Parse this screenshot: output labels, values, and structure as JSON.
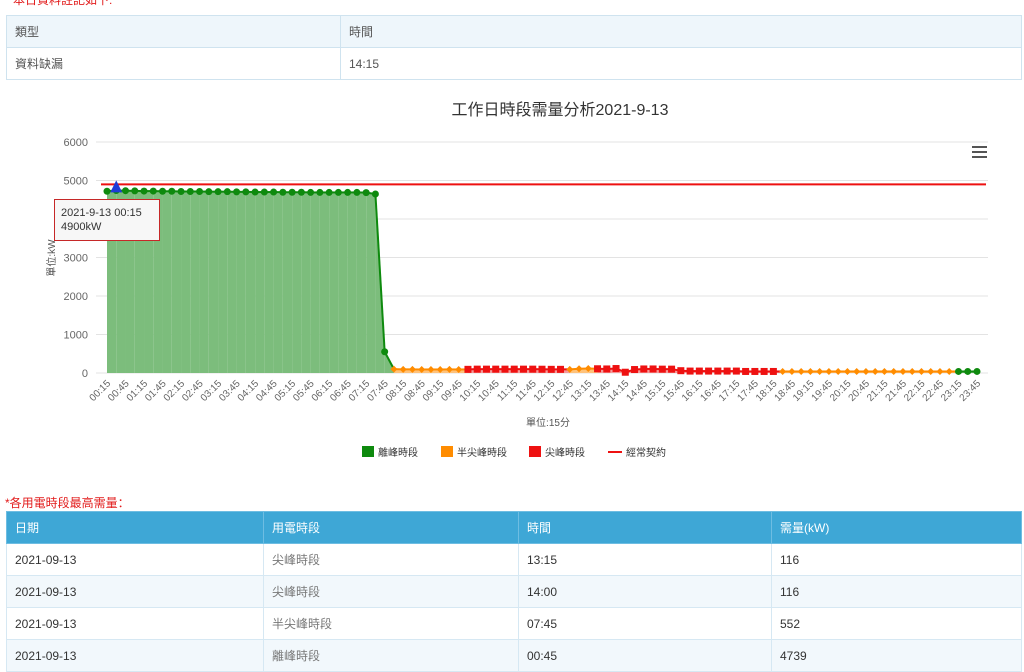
{
  "notice_top": "* 本日資料註記如下:",
  "notes_table": {
    "headers": [
      "類型",
      "時間"
    ],
    "rows": [
      [
        "資料缺漏",
        "14:15"
      ]
    ]
  },
  "chart_data": {
    "type": "area",
    "title": "工作日時段需量分析2021-9-13",
    "xlabel": "單位:15分",
    "ylabel": "單位:kW",
    "ylim": [
      0,
      6000
    ],
    "yticks": [
      0,
      1000,
      2000,
      3000,
      4000,
      5000,
      6000
    ],
    "x": [
      "00:15",
      "00:30",
      "00:45",
      "01:00",
      "01:15",
      "01:30",
      "01:45",
      "02:00",
      "02:15",
      "02:30",
      "02:45",
      "03:00",
      "03:15",
      "03:30",
      "03:45",
      "04:00",
      "04:15",
      "04:30",
      "04:45",
      "05:00",
      "05:15",
      "05:30",
      "05:45",
      "06:00",
      "06:15",
      "06:30",
      "06:45",
      "07:00",
      "07:15",
      "07:30",
      "07:45",
      "08:00",
      "08:15",
      "08:30",
      "08:45",
      "09:00",
      "09:15",
      "09:30",
      "09:45",
      "10:00",
      "10:15",
      "10:30",
      "10:45",
      "11:00",
      "11:15",
      "11:30",
      "11:45",
      "12:00",
      "12:15",
      "12:30",
      "12:45",
      "13:00",
      "13:15",
      "13:30",
      "13:45",
      "14:00",
      "14:15",
      "14:30",
      "14:45",
      "15:00",
      "15:15",
      "15:30",
      "15:45",
      "16:00",
      "16:15",
      "16:30",
      "16:45",
      "17:00",
      "17:15",
      "17:30",
      "17:45",
      "18:00",
      "18:15",
      "18:30",
      "18:45",
      "19:00",
      "19:15",
      "19:30",
      "19:45",
      "20:00",
      "20:15",
      "20:30",
      "20:45",
      "21:00",
      "21:15",
      "21:30",
      "21:45",
      "22:00",
      "22:15",
      "22:30",
      "22:45",
      "23:00",
      "23:15",
      "23:30",
      "23:45"
    ],
    "xtick_labels": [
      "00:15",
      "00:45",
      "01:15",
      "01:45",
      "02:15",
      "02:45",
      "03:15",
      "03:45",
      "04:15",
      "04:45",
      "05:15",
      "05:45",
      "06:15",
      "06:45",
      "07:15",
      "07:45",
      "08:15",
      "08:45",
      "09:15",
      "09:45",
      "10:15",
      "10:45",
      "11:15",
      "11:45",
      "12:15",
      "12:45",
      "13:15",
      "13:45",
      "14:15",
      "14:45",
      "15:15",
      "15:45",
      "16:15",
      "16:45",
      "17:15",
      "17:45",
      "18:15",
      "18:45",
      "19:15",
      "19:45",
      "20:15",
      "20:45",
      "21:15",
      "21:45",
      "22:15",
      "22:45",
      "23:15",
      "23:45"
    ],
    "values": [
      4720,
      4739,
      4735,
      4730,
      4725,
      4725,
      4720,
      4720,
      4715,
      4715,
      4715,
      4710,
      4710,
      4710,
      4705,
      4705,
      4700,
      4700,
      4700,
      4695,
      4695,
      4695,
      4690,
      4690,
      4690,
      4690,
      4690,
      4690,
      4685,
      4650,
      552,
      100,
      95,
      95,
      92,
      92,
      92,
      95,
      92,
      95,
      100,
      100,
      100,
      100,
      100,
      100,
      100,
      98,
      95,
      95,
      95,
      110,
      116,
      110,
      105,
      116,
      20,
      90,
      105,
      105,
      100,
      100,
      60,
      50,
      50,
      50,
      50,
      50,
      50,
      40,
      40,
      40,
      40,
      40,
      40,
      40,
      40,
      40,
      40,
      40,
      40,
      40,
      40,
      40,
      40,
      40,
      40,
      40,
      40,
      40,
      40,
      40,
      40,
      40,
      40
    ],
    "period_codes": "ooooooooooooooooooooooooooooooosssssssspppppppppppsssppppppppppppppppppppsssssssssssssssssssoooooo",
    "contract_kw": 4900,
    "series": [
      {
        "name": "離峰時段",
        "color": "#0e8a0e"
      },
      {
        "name": "半尖峰時段",
        "color": "#ff8c00"
      },
      {
        "name": "尖峰時段",
        "color": "#ee1111"
      },
      {
        "name": "經常契約",
        "color": "#ee1111"
      }
    ],
    "tooltip": {
      "line1": "2021-9-13 00:15",
      "line2": "4900kW"
    },
    "legend_position": "bottom-center",
    "grid": true
  },
  "notice_bottom": "*各用電時段最高需量：",
  "peak_table": {
    "headers": [
      "日期",
      "用電時段",
      "時間",
      "需量(kW)"
    ],
    "rows": [
      [
        "2021-09-13",
        "尖峰時段",
        "13:15",
        "116"
      ],
      [
        "2021-09-13",
        "尖峰時段",
        "14:00",
        "116"
      ],
      [
        "2021-09-13",
        "半尖峰時段",
        "07:45",
        "552"
      ],
      [
        "2021-09-13",
        "離峰時段",
        "00:45",
        "4739"
      ]
    ]
  }
}
